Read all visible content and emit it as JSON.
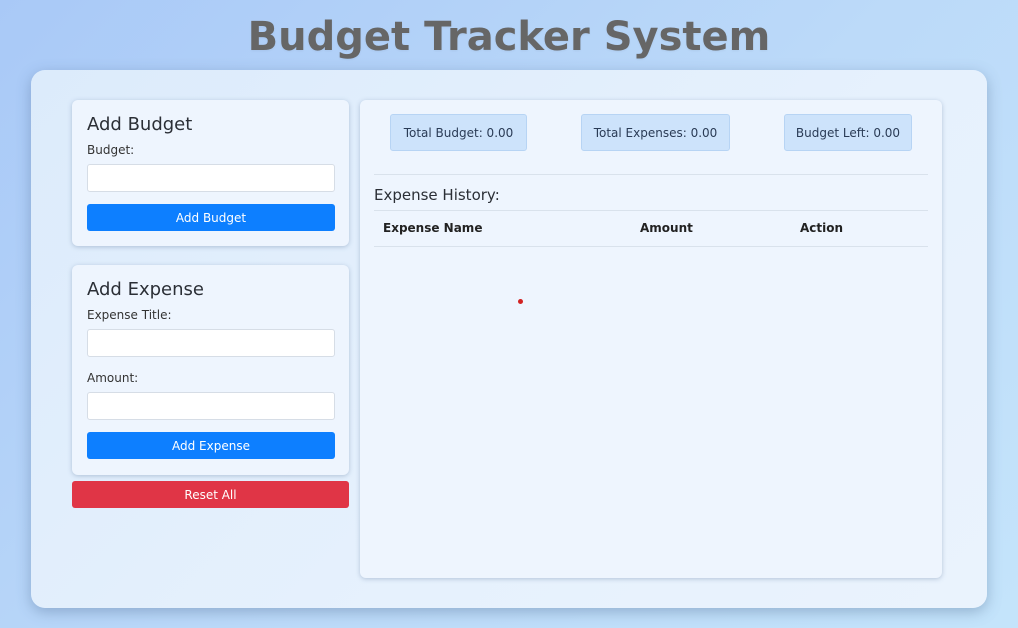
{
  "page": {
    "title": "Budget Tracker System"
  },
  "budget_form": {
    "heading": "Add Budget",
    "budget_label": "Budget:",
    "budget_value": "",
    "submit_label": "Add Budget"
  },
  "expense_form": {
    "heading": "Add Expense",
    "title_label": "Expense Title:",
    "title_value": "",
    "amount_label": "Amount:",
    "amount_value": "",
    "submit_label": "Add Expense"
  },
  "reset": {
    "label": "Reset All"
  },
  "summary": {
    "total_budget": "Total Budget: 0.00",
    "total_expenses": "Total Expenses: 0.00",
    "budget_left": "Budget Left: 0.00"
  },
  "history": {
    "title": "Expense History:",
    "columns": [
      "Expense Name",
      "Amount",
      "Action"
    ],
    "rows": []
  },
  "colors": {
    "primary": "#0d7fff",
    "danger": "#e03546",
    "title": "#666666"
  }
}
